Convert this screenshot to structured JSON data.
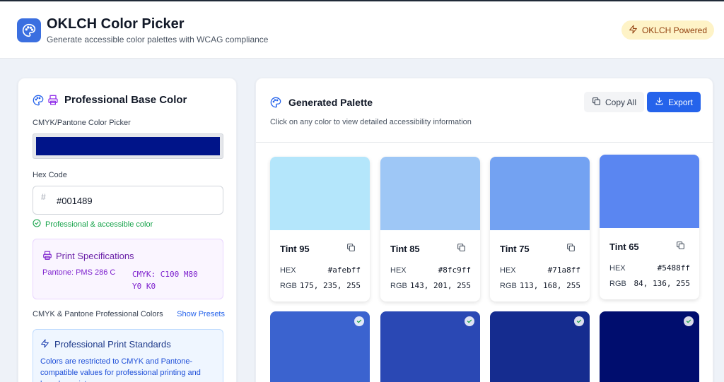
{
  "app": {
    "title": "OKLCH Color Picker",
    "subtitle": "Generate accessible color palettes with WCAG compliance",
    "badge": "OKLCH Powered",
    "logo_icon": "palette-icon",
    "accent": "#3b6fe0"
  },
  "left": {
    "title": "Professional Base Color",
    "picker_label": "CMYK/Pantone Color Picker",
    "picker_color": "#001489",
    "hex_label": "Hex Code",
    "hex_prefix": "#",
    "hex_value": "#001489",
    "status": "Professional & accessible color",
    "print_spec": {
      "title": "Print Specifications",
      "pantone": "Pantone:  PMS 286 C",
      "cmyk": "CMYK: C100 M80 Y0 K0"
    },
    "presets_label": "CMYK & Pantone Professional Colors",
    "presets_link": "Show Presets",
    "standards": {
      "title": "Professional Print Standards",
      "text": "Colors are restricted to CMYK and Pantone-compatible values for professional printing and brand consistency."
    }
  },
  "right": {
    "title": "Generated Palette",
    "subtitle": "Click on any color to view detailed accessibility information",
    "copy_all": "Copy All",
    "export": "Export",
    "hex_label": "HEX",
    "rgb_label": "RGB",
    "tints": [
      {
        "name": "Tint 95",
        "hex": "#afebff",
        "rgb": "175, 235, 255",
        "color": "#b4e6fb"
      },
      {
        "name": "Tint 85",
        "hex": "#8fc9ff",
        "rgb": "143, 201, 255",
        "color": "#9ec7f6"
      },
      {
        "name": "Tint 75",
        "hex": "#71a8ff",
        "rgb": "113, 168, 255",
        "color": "#73a2f2"
      },
      {
        "name": "Tint 65",
        "hex": "#5488ff",
        "rgb": " 84, 136, 255",
        "color": "#5a86f1"
      }
    ],
    "shades": [
      {
        "color": "#3b63cf"
      },
      {
        "color": "#2a48b4"
      },
      {
        "color": "#152c8f"
      },
      {
        "color": "#000d6e"
      }
    ]
  }
}
